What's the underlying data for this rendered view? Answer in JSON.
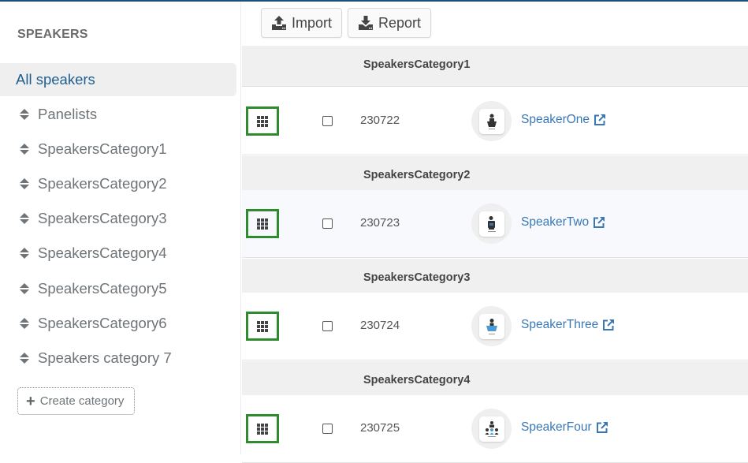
{
  "sidebar": {
    "title": "SPEAKERS",
    "items": [
      {
        "label": "All speakers",
        "active": true,
        "sortable": false
      },
      {
        "label": "Panelists",
        "active": false,
        "sortable": true
      },
      {
        "label": "SpeakersCategory1",
        "active": false,
        "sortable": true
      },
      {
        "label": "SpeakersCategory2",
        "active": false,
        "sortable": true
      },
      {
        "label": "SpeakersCategory3",
        "active": false,
        "sortable": true
      },
      {
        "label": "SpeakersCategory4",
        "active": false,
        "sortable": true
      },
      {
        "label": "SpeakersCategory5",
        "active": false,
        "sortable": true
      },
      {
        "label": "SpeakersCategory6",
        "active": false,
        "sortable": true
      },
      {
        "label": "Speakers category 7",
        "active": false,
        "sortable": true
      }
    ],
    "create_label": "Create category"
  },
  "toolbar": {
    "import_label": "Import",
    "report_label": "Report"
  },
  "groups": [
    {
      "category": "SpeakersCategory1",
      "speaker": {
        "id": "230722",
        "name": "SpeakerOne",
        "icon": "podium-speaker-icon"
      }
    },
    {
      "category": "SpeakersCategory2",
      "speaker": {
        "id": "230723",
        "name": "SpeakerTwo",
        "icon": "standing-speaker-icon"
      }
    },
    {
      "category": "SpeakersCategory3",
      "speaker": {
        "id": "230724",
        "name": "SpeakerThree",
        "icon": "blue-podium-speaker-icon"
      }
    },
    {
      "category": "SpeakersCategory4",
      "speaker": {
        "id": "230725",
        "name": "SpeakerFour",
        "icon": "audience-speaker-icon"
      }
    }
  ],
  "colors": {
    "accent": "#1f4e79",
    "link": "#3a78b5",
    "highlight_border": "#2e8b2e"
  }
}
